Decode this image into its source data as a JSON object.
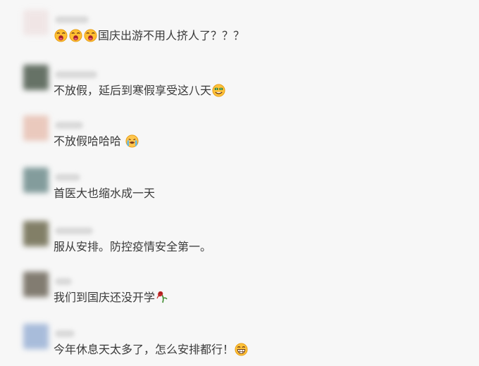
{
  "comments": [
    {
      "text": "国庆出游不用人挤人了？？？",
      "avatar_color": "#efe3e3"
    },
    {
      "text": "不放假，延后到寒假享受这八天",
      "avatar_color": "#4d5b4d"
    },
    {
      "text": "不放假哈哈哈 ",
      "avatar_color": "#e8c1b3"
    },
    {
      "text": "首医大也缩水成一天",
      "avatar_color": "#6f8d8d"
    },
    {
      "text": "服从安排。防控疫情安全第一。",
      "avatar_color": "#6e6b4f"
    },
    {
      "text": "我们到国庆还没开学",
      "avatar_color": "#6e675a"
    },
    {
      "text": "今年休息天太多了，怎么安排都行！",
      "avatar_color": "#9bb2d6"
    }
  ],
  "icons": {
    "surprised": "surprised-face-icon",
    "greedy": "greedy-face-icon",
    "crying": "crying-face-icon",
    "rose": "wilted-rose-icon",
    "grin": "grinning-face-icon"
  }
}
